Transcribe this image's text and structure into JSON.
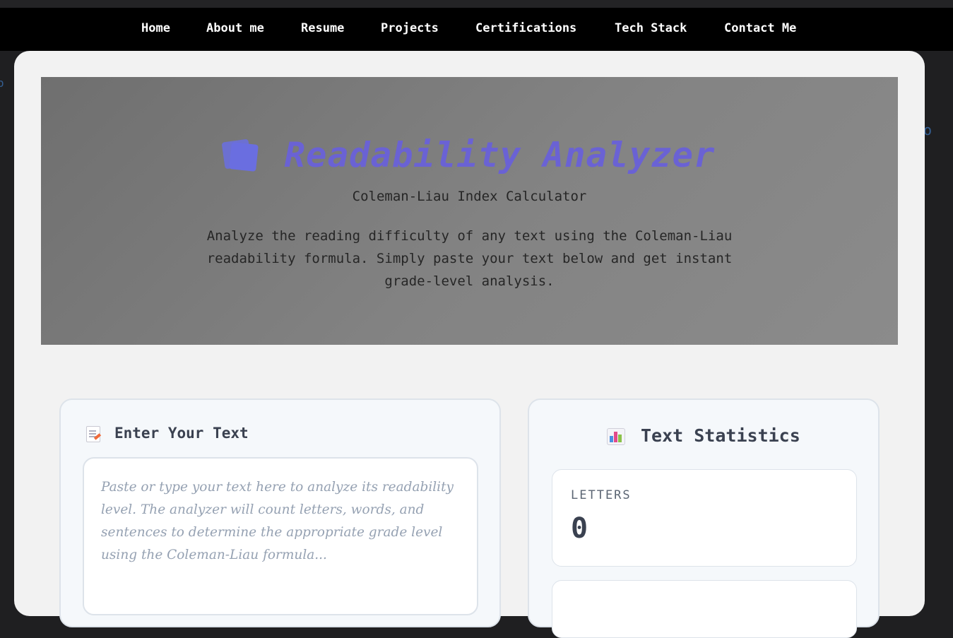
{
  "nav": {
    "items": [
      {
        "label": "Home"
      },
      {
        "label": "About me"
      },
      {
        "label": "Resume"
      },
      {
        "label": "Projects"
      },
      {
        "label": "Certifications"
      },
      {
        "label": "Tech Stack"
      },
      {
        "label": "Contact Me"
      }
    ]
  },
  "hero": {
    "icon": "books-icon",
    "title": "Readability Analyzer",
    "subtitle": "Coleman-Liau Index Calculator",
    "description": "Analyze the reading difficulty of any text using the Coleman-Liau readability formula. Simply paste your text below and get instant grade-level analysis."
  },
  "input_panel": {
    "icon": "memo-icon",
    "heading": "Enter Your Text",
    "value": "",
    "placeholder": "Paste or type your text here to analyze its readability level. The analyzer will count letters, words, and sentences to determine the appropriate grade level using the Coleman-Liau formula..."
  },
  "stats_panel": {
    "icon": "bar-chart-icon",
    "heading": "Text Statistics",
    "stats": [
      {
        "label": "LETTERS",
        "value": "0"
      }
    ]
  },
  "colors": {
    "accent": "#6a62d4",
    "nav_bg": "#000000",
    "card_bg": "#f2f2f2",
    "panel_bg": "#f5f8fb"
  }
}
